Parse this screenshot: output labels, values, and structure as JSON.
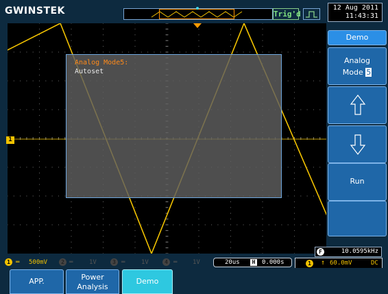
{
  "brand": {
    "logo": "GWINSTEK"
  },
  "header": {
    "trigger_status": "Trig'd",
    "date": "12 Aug 2011",
    "time": "11:43:31"
  },
  "dialog": {
    "title": "Analog Mode5:",
    "item": "Autoset"
  },
  "menu": {
    "title": "Demo",
    "analog_label": "Analog",
    "mode_label": "Mode",
    "mode_value": "5",
    "up_icon": "up-arrow-icon",
    "down_icon": "down-arrow-icon",
    "run_label": "Run"
  },
  "frequency": {
    "badge": "F",
    "value": "10.0595kHz"
  },
  "channels": [
    {
      "badge": "1",
      "coupling": "═",
      "scale": "500mV",
      "color": "#f2c200"
    },
    {
      "badge": "2",
      "coupling": "═",
      "scale": "1V",
      "color": "#555555"
    },
    {
      "badge": "3",
      "coupling": "═",
      "scale": "1V",
      "color": "#555555"
    },
    {
      "badge": "4",
      "coupling": "═",
      "scale": "1V",
      "color": "#555555"
    }
  ],
  "timebase": {
    "scale": "20us",
    "h_badge": "H",
    "position": "0.000s"
  },
  "trigger": {
    "source": "1",
    "slope": "↑",
    "level": "60.0mV",
    "coupling": "DC"
  },
  "tabs": [
    {
      "label": "APP."
    },
    {
      "label_line1": "Power",
      "label_line2": "Analysis"
    },
    {
      "label": "Demo",
      "active": true
    }
  ],
  "colors": {
    "ch1": "#f2c200",
    "accent": "#1f67a8",
    "active_tab": "#2ec8e0"
  }
}
